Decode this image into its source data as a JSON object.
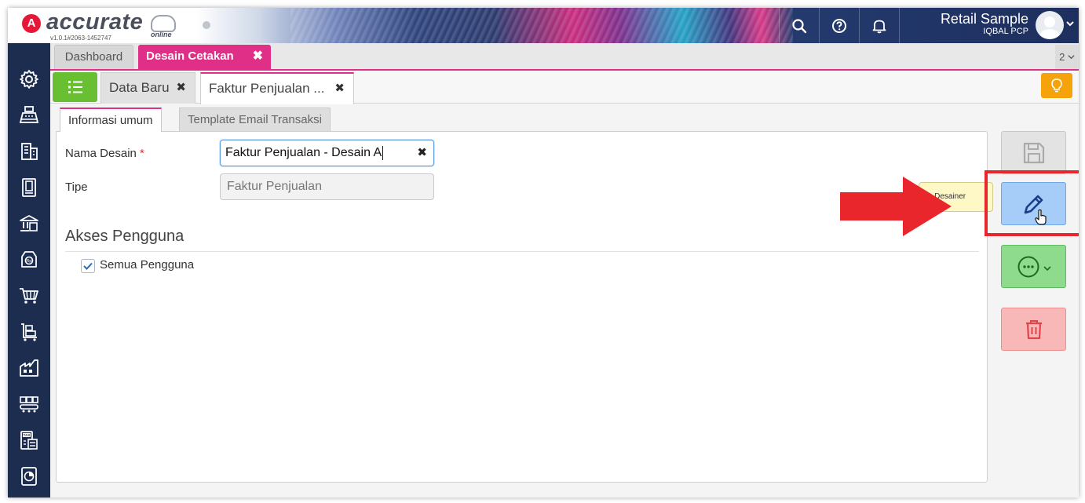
{
  "app": {
    "logo_text": "accurate",
    "logo_sub": "online",
    "version": "v1.0.1#2063-1452747"
  },
  "header": {
    "company": "Retail Sample",
    "user": "IQBAL PCP",
    "icons": [
      "search-icon",
      "help-icon",
      "bell-icon"
    ]
  },
  "sidebar": {
    "items": [
      "settings-icon",
      "sales-register-icon",
      "company-icon",
      "ledger-book-icon",
      "bank-icon",
      "receivable-tag-icon",
      "purchase-cart-icon",
      "inventory-trolley-icon",
      "warehouse-factory-icon",
      "manufacturing-icon",
      "tax-icon",
      "report-chart-icon"
    ]
  },
  "module_tabs": {
    "dashboard": "Dashboard",
    "active": "Desain Cetakan",
    "page_count": "2"
  },
  "doc_tabs": {
    "data_baru": "Data Baru",
    "faktur": "Faktur Penjualan ..."
  },
  "inner_tabs": {
    "info": "Informasi umum",
    "email": "Template Email Transaksi"
  },
  "form": {
    "nama_label": "Nama Desain",
    "required_mark": "*",
    "nama_value": "Faktur Penjualan - Desain A",
    "tipe_label": "Tipe",
    "tipe_value": "Faktur Penjualan",
    "section_title": "Akses Pengguna",
    "checkbox_label": "Semua Pengguna",
    "checkbox_checked": true
  },
  "actions": {
    "tooltip": "... Desainer"
  },
  "colors": {
    "accent_pink": "#e02f86",
    "sidebar": "#1d2d50",
    "edit_button": "#a6cdf7",
    "more_button": "#8edb8e",
    "delete_button": "#f8b8b8",
    "highlight": "#e8262c"
  }
}
